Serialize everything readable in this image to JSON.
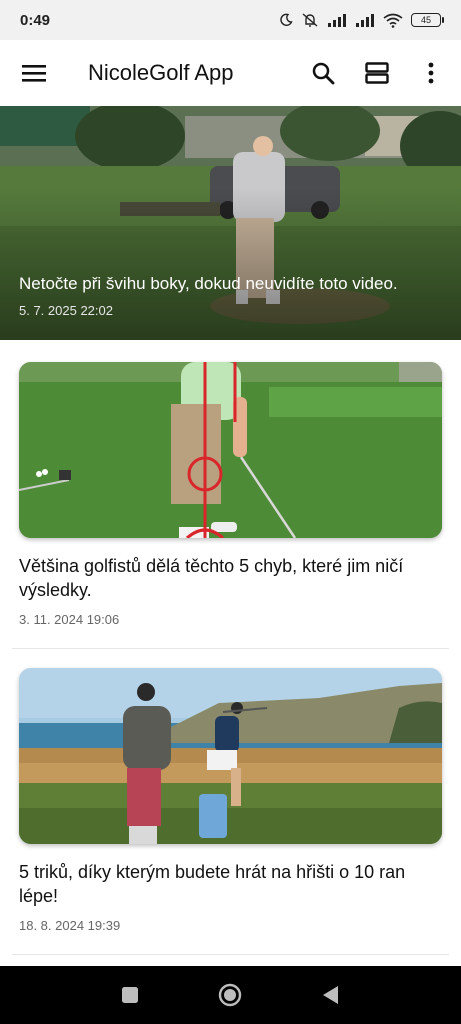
{
  "status_bar": {
    "time": "0:49",
    "battery": "45",
    "icons": [
      "moon-icon",
      "mute-vibrate-icon",
      "signal-icon",
      "signal-icon",
      "wifi-icon",
      "battery-icon"
    ]
  },
  "app_bar": {
    "title": "NicoleGolf App",
    "icons": [
      "menu-icon",
      "search-icon",
      "view-toggle-icon",
      "more-vert-icon"
    ]
  },
  "featured": {
    "title": "Netočte při švihu boky, dokud neuvidíte toto video.",
    "date": "5. 7. 2025 22:02"
  },
  "articles": [
    {
      "title": "Většina golfistů dělá těchto 5 chyb, které jim ničí výsledky.",
      "date": "3. 11. 2024 19:06"
    },
    {
      "title": "5 triků, díky kterým budete hrát na hřišti o 10 ran lépe!",
      "date": "18. 8. 2024 19:39"
    }
  ],
  "colors": {
    "accent_red": "#d8262b",
    "status_bar_bg": "#f1f1f1",
    "nav_bar_bg": "#000000"
  },
  "nav": {
    "icons": [
      "recents-square-icon",
      "home-circle-icon",
      "back-triangle-icon"
    ]
  }
}
